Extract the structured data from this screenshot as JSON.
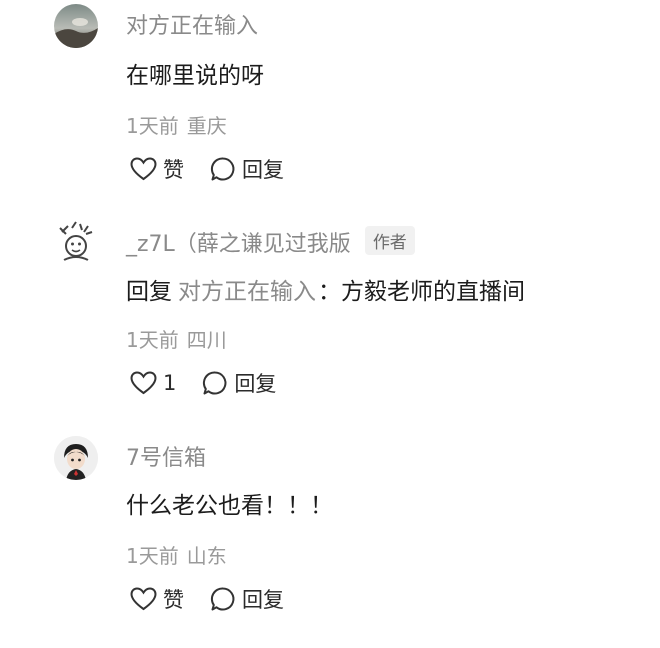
{
  "comments": [
    {
      "name": "对方正在输入",
      "text": "在哪里说的呀",
      "time": "1天前",
      "location": "重庆",
      "like_label": "赞",
      "reply_label": "回复"
    },
    {
      "name": "_z7L（薛之谦见过我版",
      "author_badge": "作者",
      "reply_prefix": "回复",
      "reply_to": "对方正在输入",
      "reply_colon": "：",
      "text": "方毅老师的直播间",
      "time": "1天前",
      "location": "四川",
      "like_label": "1",
      "reply_label": "回复"
    },
    {
      "name": "7号信箱",
      "text": "什么老公也看！！！",
      "time": "1天前",
      "location": "山东",
      "like_label": "赞",
      "reply_label": "回复"
    }
  ]
}
